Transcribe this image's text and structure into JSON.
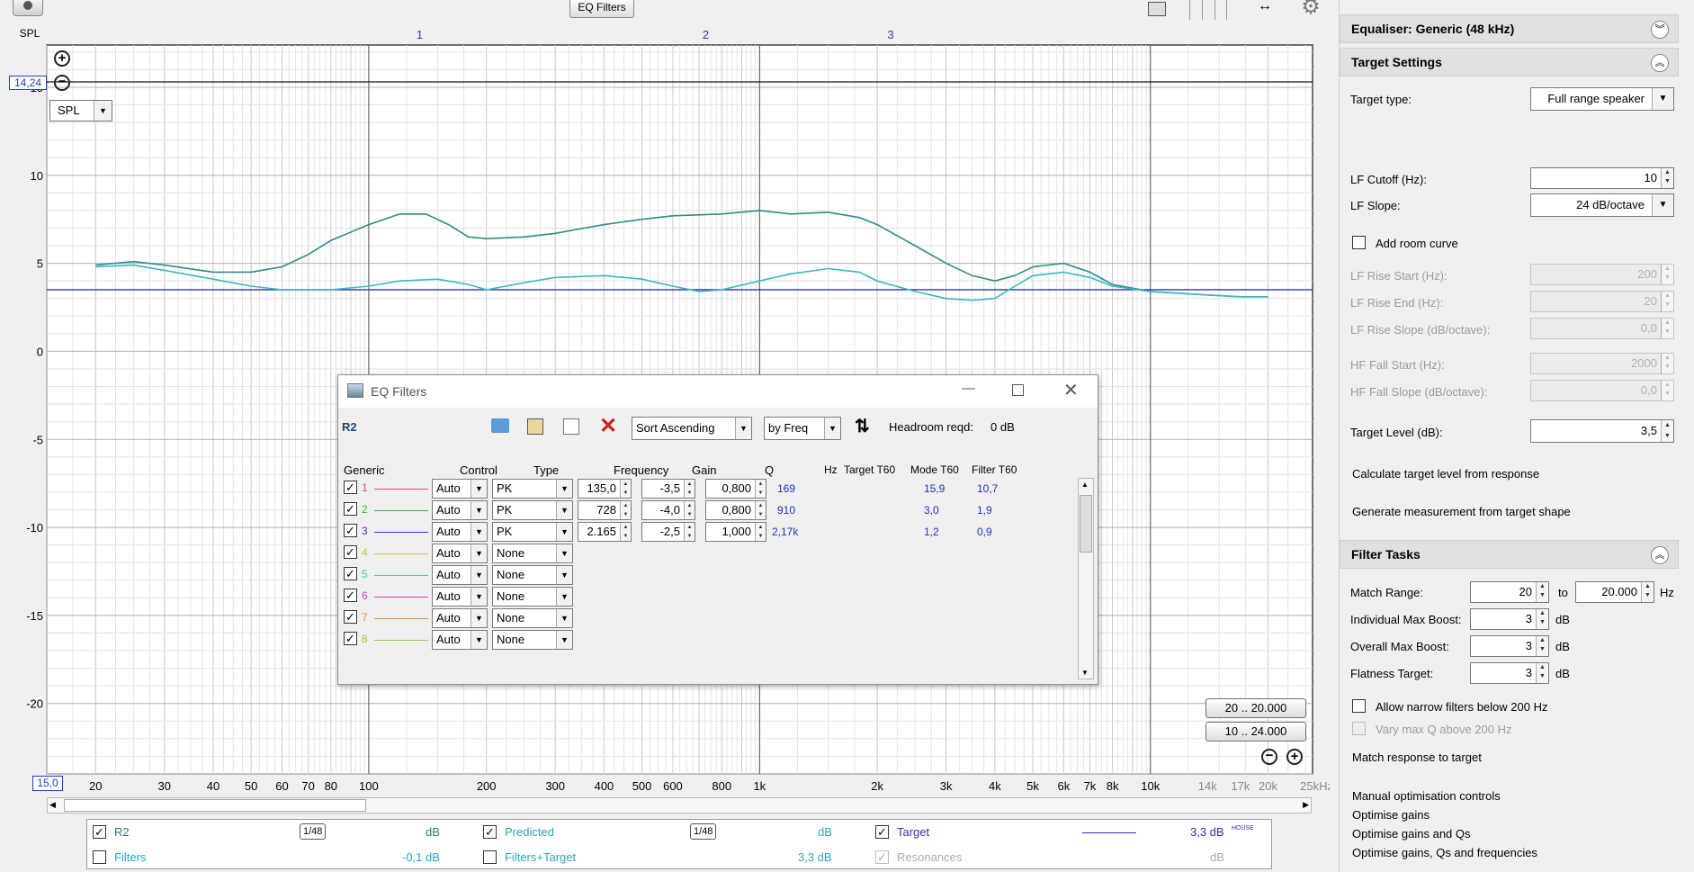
{
  "toolbar": {
    "eq_filters_button": "EQ Filters"
  },
  "graph": {
    "y_axis_label": "SPL",
    "y_ticks": [
      "15",
      "10",
      "5",
      "0",
      "-5",
      "-10",
      "-15",
      "-20"
    ],
    "cursor_value": "14,24",
    "x_min_value": "15,0",
    "x_ticks": [
      "20",
      "30",
      "40",
      "50",
      "60",
      "70",
      "80",
      "100",
      "200",
      "300",
      "400",
      "500",
      "600",
      "800",
      "1k",
      "2k",
      "3k",
      "4k",
      "5k",
      "6k",
      "7k",
      "8k",
      "10k"
    ],
    "x_ticks_high": [
      "14k",
      "17k",
      "20k",
      "25kHz"
    ],
    "filter_markers": [
      "1",
      "2",
      "3"
    ],
    "spl_dropdown": "SPL",
    "range_button_1": "20 .. 20.000",
    "range_button_2": "10 .. 24.000"
  },
  "legend": {
    "r2": {
      "label": "R2",
      "smoothing": "1/48",
      "value": "dB"
    },
    "predicted": {
      "label": "Predicted",
      "smoothing": "1/48",
      "value": "dB"
    },
    "target": {
      "label": "Target",
      "value": "3,3 dB",
      "sup": "HOUSE"
    },
    "filters": {
      "label": "Filters",
      "value": "-0,1 dB"
    },
    "filters_target": {
      "label": "Filters+Target",
      "value": "3,3 dB"
    },
    "resonances": {
      "label": "Resonances",
      "value": "dB"
    },
    "colors": {
      "r2": "#2e8b8b",
      "predicted": "#3ab8c0",
      "target": "#3030b0"
    }
  },
  "eq_dialog": {
    "title": "EQ Filters",
    "name": "R2",
    "sort": "Sort Ascending",
    "sort_by": "by Freq",
    "headroom_label": "Headroom reqd:",
    "headroom_value": "0 dB",
    "columns": {
      "generic": "Generic",
      "control": "Control",
      "type": "Type",
      "frequency": "Frequency",
      "gain": "Gain",
      "q": "Q",
      "hz": "Hz",
      "target_t60": "Target T60",
      "mode_t60": "Mode T60",
      "filter_t60": "Filter T60"
    },
    "filters": [
      {
        "num": "1",
        "color": "#e05050",
        "control": "Auto",
        "type": "PK",
        "freq": "135,0",
        "gain": "-3,5",
        "q": "0,800",
        "hz": "169",
        "mode_t60": "15,9",
        "filter_t60": "10,7"
      },
      {
        "num": "2",
        "color": "#40b040",
        "control": "Auto",
        "type": "PK",
        "freq": "728",
        "gain": "-4,0",
        "q": "0,800",
        "hz": "910",
        "mode_t60": "3,0",
        "filter_t60": "1,9"
      },
      {
        "num": "3",
        "color": "#4040c0",
        "control": "Auto",
        "type": "PK",
        "freq": "2.165",
        "gain": "-2,5",
        "q": "1,000",
        "hz": "2,17k",
        "mode_t60": "1,2",
        "filter_t60": "0,9"
      },
      {
        "num": "4",
        "color": "#d8c040",
        "control": "Auto",
        "type": "None"
      },
      {
        "num": "5",
        "color": "#40c8c8",
        "control": "Auto",
        "type": "None"
      },
      {
        "num": "6",
        "color": "#d040d0",
        "control": "Auto",
        "type": "None"
      },
      {
        "num": "7",
        "color": "#e09040",
        "control": "Auto",
        "type": "None"
      },
      {
        "num": "8",
        "color": "#90d040",
        "control": "Auto",
        "type": "None"
      }
    ]
  },
  "right_panel": {
    "equaliser_header": "Equaliser: Generic (48 kHz)",
    "target_header": "Target Settings",
    "target_type_label": "Target type:",
    "target_type_value": "Full range speaker",
    "lf_cutoff_label": "LF Cutoff (Hz):",
    "lf_cutoff_value": "10",
    "lf_slope_label": "LF Slope:",
    "lf_slope_value": "24 dB/octave",
    "add_room_curve": "Add room curve",
    "lf_rise_start_label": "LF Rise Start (Hz):",
    "lf_rise_start_value": "200",
    "lf_rise_end_label": "LF Rise End (Hz):",
    "lf_rise_end_value": "20",
    "lf_rise_slope_label": "LF Rise Slope (dB/octave):",
    "lf_rise_slope_value": "0,0",
    "hf_fall_start_label": "HF Fall Start (Hz):",
    "hf_fall_start_value": "2000",
    "hf_fall_slope_label": "HF Fall Slope (dB/octave):",
    "hf_fall_slope_value": "0,0",
    "target_level_label": "Target Level (dB):",
    "target_level_value": "3,5",
    "calc_target": "Calculate target level from response",
    "gen_measurement": "Generate measurement from target shape",
    "filter_tasks_header": "Filter Tasks",
    "match_range_label": "Match Range:",
    "match_range_from": "20",
    "match_range_to_label": "to",
    "match_range_to": "20.000",
    "hz_unit": "Hz",
    "indiv_boost_label": "Individual Max Boost:",
    "indiv_boost_value": "3",
    "overall_boost_label": "Overall Max Boost:",
    "overall_boost_value": "3",
    "flatness_label": "Flatness Target:",
    "flatness_value": "3",
    "db_unit": "dB",
    "allow_narrow": "Allow narrow filters below 200 Hz",
    "vary_max_q": "Vary max Q above 200 Hz",
    "match_response": "Match response to target",
    "manual_opt": "Manual optimisation controls",
    "opt_gains": "Optimise gains",
    "opt_gains_qs": "Optimise gains and Qs",
    "opt_gains_qs_freqs": "Optimise gains, Qs and frequencies"
  }
}
